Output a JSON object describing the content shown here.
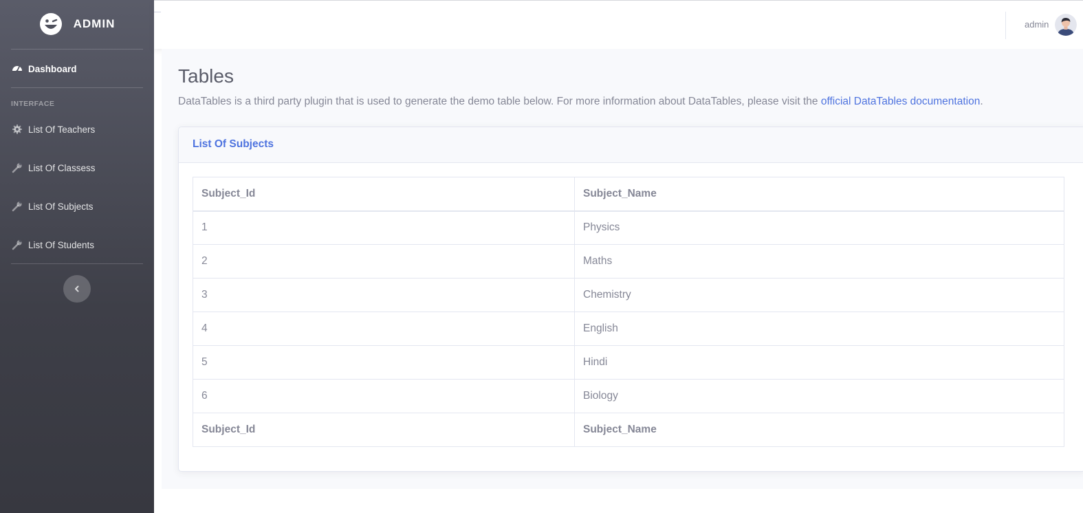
{
  "sidebar": {
    "brand": "ADMIN",
    "dashboard_label": "Dashboard",
    "heading": "INTERFACE",
    "items": [
      {
        "label": "List Of Teachers",
        "icon": "gear-icon"
      },
      {
        "label": "List Of Classess",
        "icon": "wrench-icon"
      },
      {
        "label": "List Of Subjects",
        "icon": "wrench-icon"
      },
      {
        "label": "List Of Students",
        "icon": "wrench-icon"
      }
    ],
    "toggle_icon": "chevron-left-icon"
  },
  "topbar": {
    "user_name": "admin"
  },
  "page": {
    "title": "Tables",
    "description": "DataTables is a third party plugin that is used to generate the demo table below. For more information about DataTables, please visit the",
    "link_text": "official DataTables documentation",
    "description_end": "."
  },
  "card": {
    "title": "List Of Subjects",
    "columns": [
      "Subject_Id",
      "Subject_Name"
    ],
    "rows": [
      [
        "1",
        "Physics"
      ],
      [
        "2",
        "Maths"
      ],
      [
        "3",
        "Chemistry"
      ],
      [
        "4",
        "English"
      ],
      [
        "5",
        "Hindi"
      ],
      [
        "6",
        "Biology"
      ]
    ]
  },
  "colors": {
    "sidebar_top": "#5a5c69",
    "sidebar_bottom": "#373840",
    "accent": "#4e73df",
    "text": "#858796",
    "content_bg": "#f8f9fc"
  }
}
